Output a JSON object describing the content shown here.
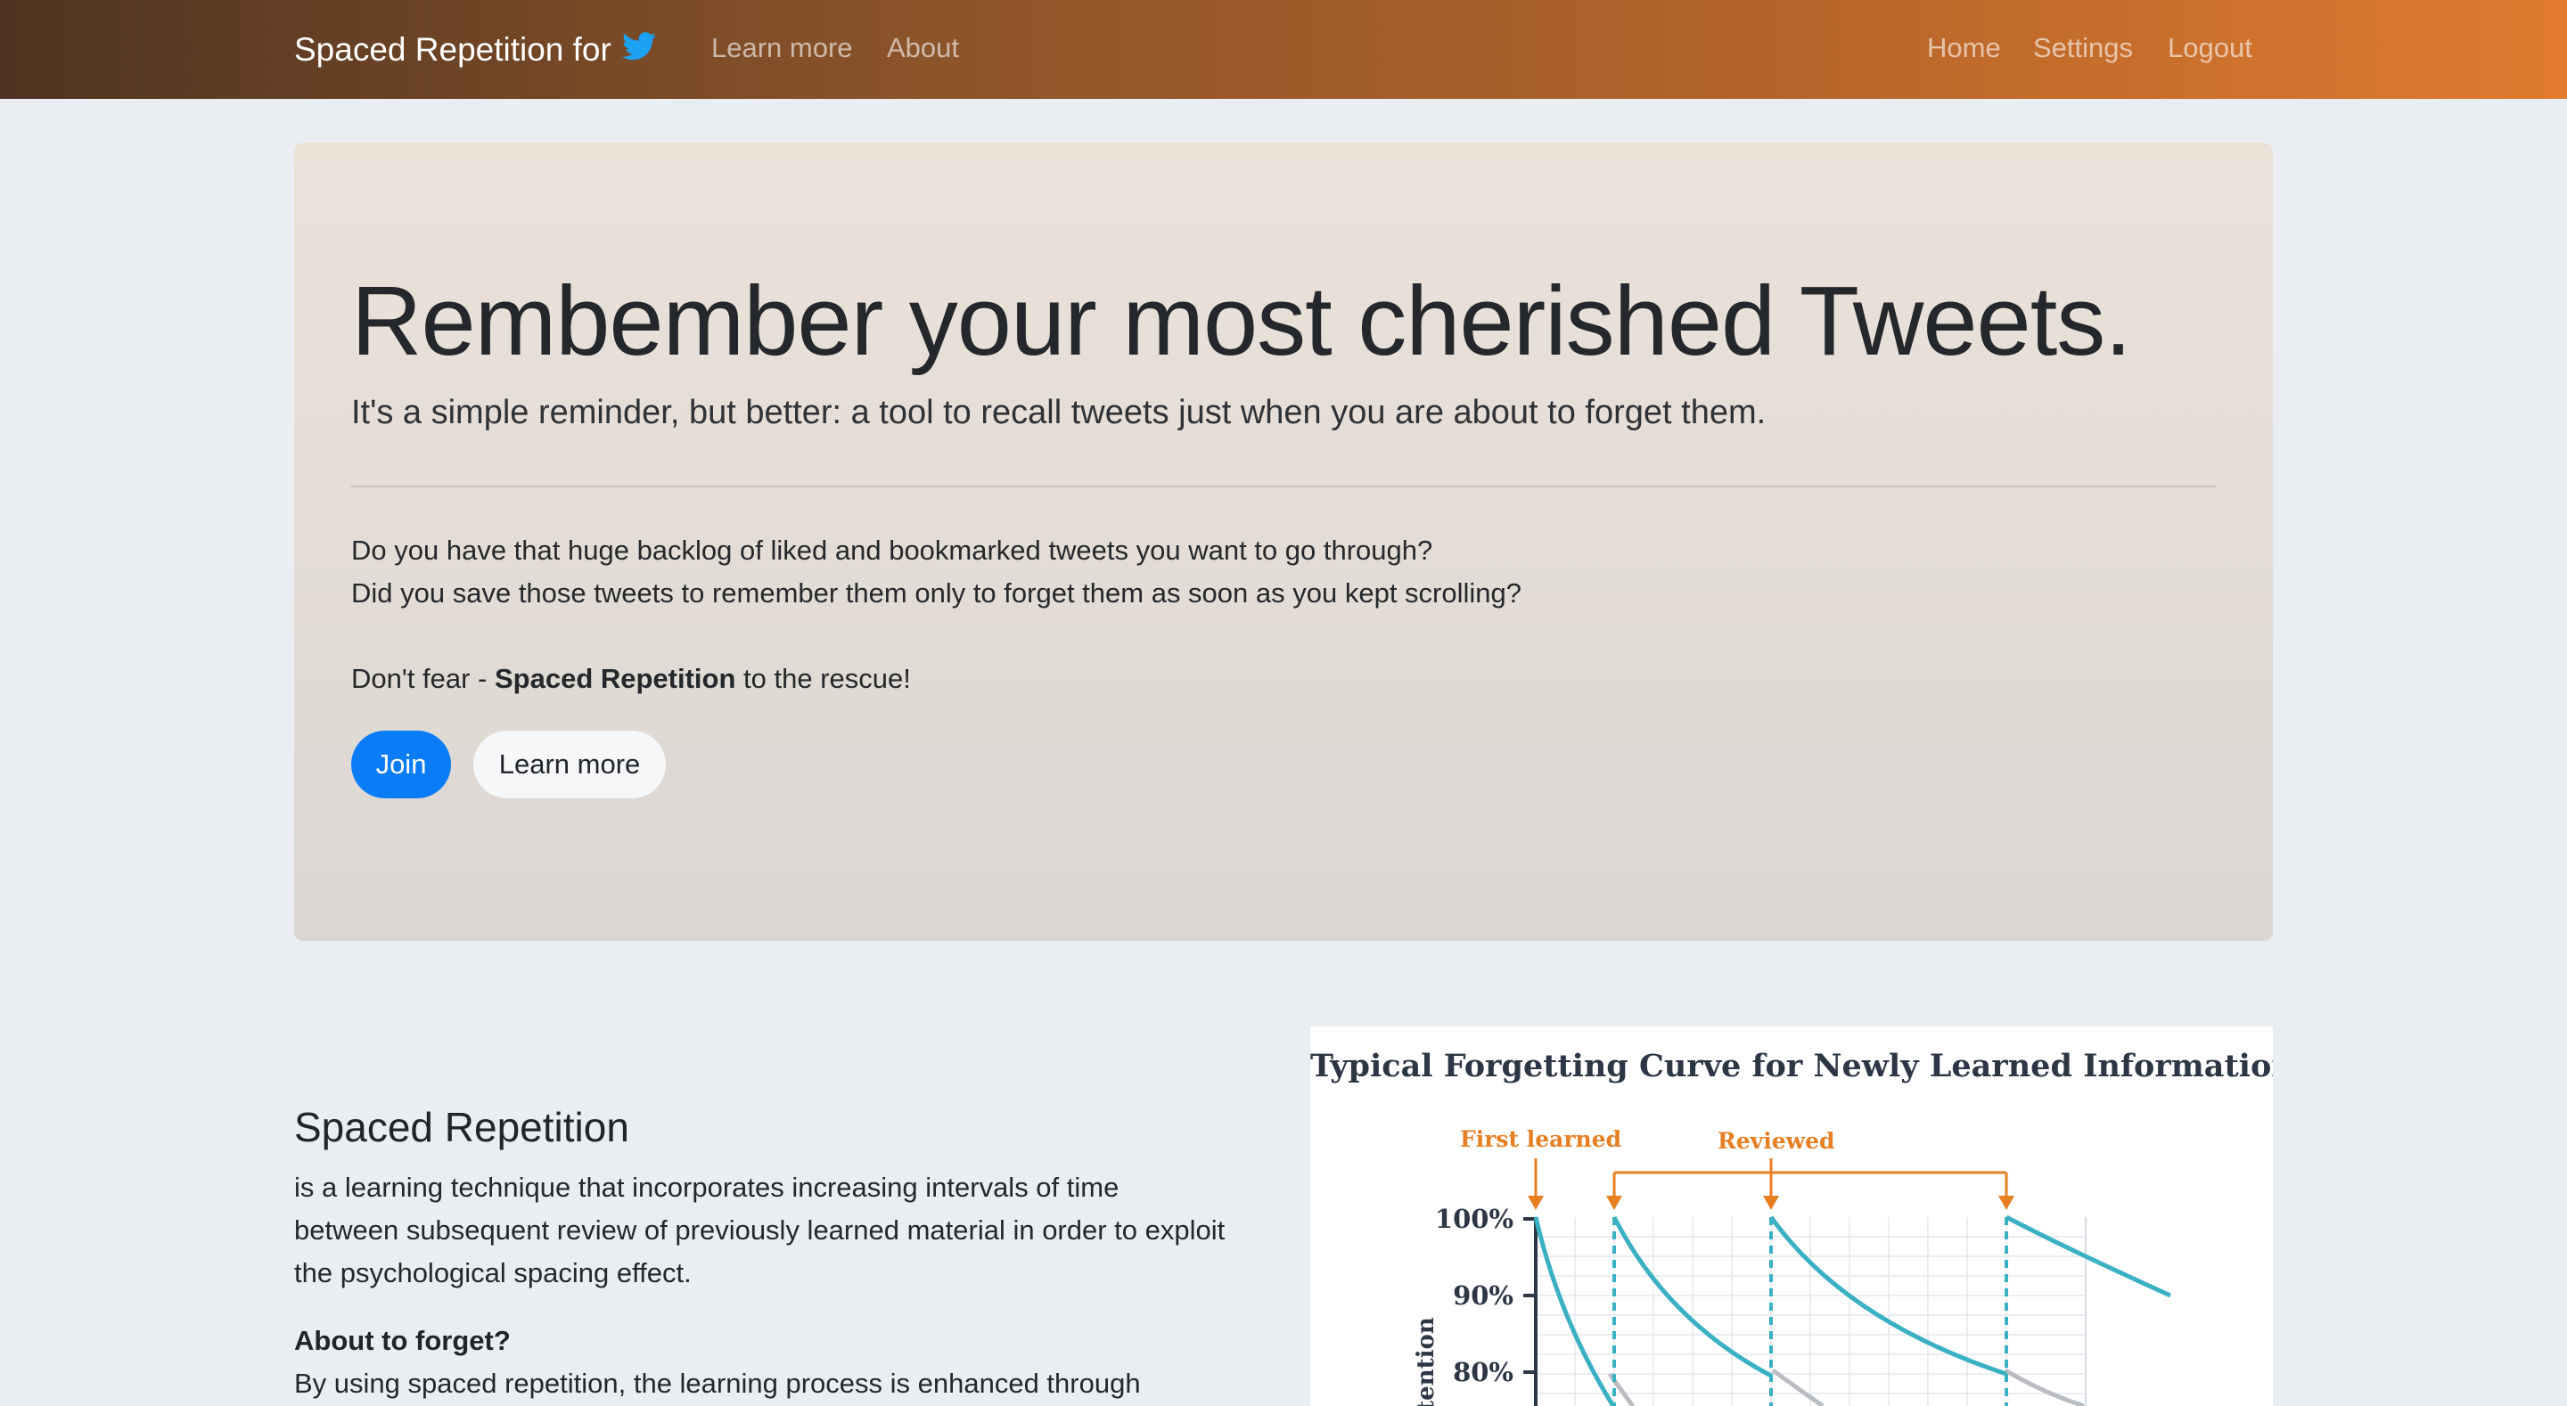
{
  "nav": {
    "brand": "Spaced Repetition for",
    "brand_icon": "twitter-bird-icon",
    "left_links": [
      "Learn more",
      "About"
    ],
    "right_links": [
      "Home",
      "Settings",
      "Logout"
    ]
  },
  "hero": {
    "title": "Rembember your most cherished Tweets.",
    "subtitle": "It's a simple reminder, but better: a tool to recall tweets just when you are about to forget them.",
    "line1": "Do you have that huge backlog of liked and bookmarked tweets you want to go through?",
    "line2": "Did you save those tweets to remember them only to forget them as soon as you kept scrolling?",
    "rescue_prefix": "Don't fear - ",
    "rescue_bold": "Spaced Repetition",
    "rescue_suffix": " to the rescue!",
    "join_label": "Join",
    "learn_label": "Learn more"
  },
  "section": {
    "title": "Spaced Repetition",
    "text": "is a learning technique that incorporates increasing intervals of time between subsequent review of previously learned material in order to exploit the psychological spacing effect.",
    "subheading": "About to forget?",
    "text2": "By using spaced repetition, the learning process is enhanced through"
  },
  "figure": {
    "title": "Typical Forgetting Curve for Newly Learned Information",
    "first_learned": "First learned",
    "reviewed": "Reviewed",
    "y_ticks": [
      "100%",
      "90%",
      "80%"
    ],
    "y_label": "Retention"
  },
  "colors": {
    "nav_gradient_start": "#4f3421",
    "nav_gradient_end": "#e07b30",
    "primary": "#0a7cf8",
    "twitter": "#1da1f2",
    "curve": "#3ab0c3",
    "annotation": "#e67e22"
  }
}
